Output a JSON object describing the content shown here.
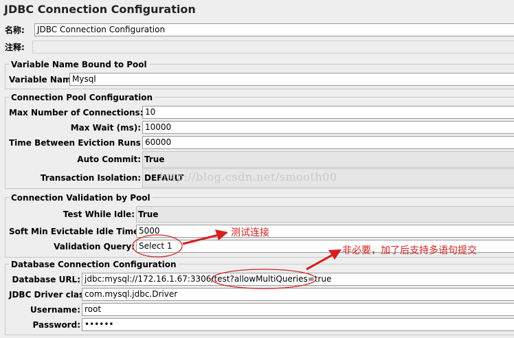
{
  "window": {
    "title": "JDBC Connection Configuration"
  },
  "general": {
    "name_label": "名称:",
    "name_value": "JDBC Connection Configuration",
    "comments_label": "注释:",
    "comments_value": ""
  },
  "pool_binding": {
    "legend": "Variable Name Bound to Pool",
    "variable_name_label": "Variable Name:",
    "variable_name_value": "Mysql"
  },
  "pool_config": {
    "legend": "Connection Pool Configuration",
    "max_connections_label": "Max Number of Connections:",
    "max_connections_value": "10",
    "max_wait_label": "Max Wait (ms):",
    "max_wait_value": "10000",
    "eviction_label": "Time Between Eviction Runs (ms):",
    "eviction_value": "60000",
    "auto_commit_label": "Auto Commit:",
    "auto_commit_value": "True",
    "isolation_label": "Transaction Isolation:",
    "isolation_value": "DEFAULT"
  },
  "validation": {
    "legend": "Connection Validation by Pool",
    "test_idle_label": "Test While Idle:",
    "test_idle_value": "True",
    "soft_min_label": "Soft Min Evictable Idle Time(ms):",
    "soft_min_value": "5000",
    "query_label": "Validation Query:",
    "query_value": "Select 1"
  },
  "database": {
    "legend": "Database Connection Configuration",
    "url_label": "Database URL:",
    "url_value": "jdbc:mysql://172.16.1.67:3306/test?allowMultiQueries=true",
    "driver_label": "JDBC Driver class:",
    "driver_value": "com.mysql.jdbc.Driver",
    "username_label": "Username:",
    "username_value": "root",
    "password_label": "Password:",
    "password_value": "••••••"
  },
  "watermark": "http://blog.csdn.net/smooth00",
  "annotations": {
    "test_connection": "测试连接",
    "multi_query_note": "非必要，加了后支持多语句提交",
    "color": "#d42020"
  }
}
